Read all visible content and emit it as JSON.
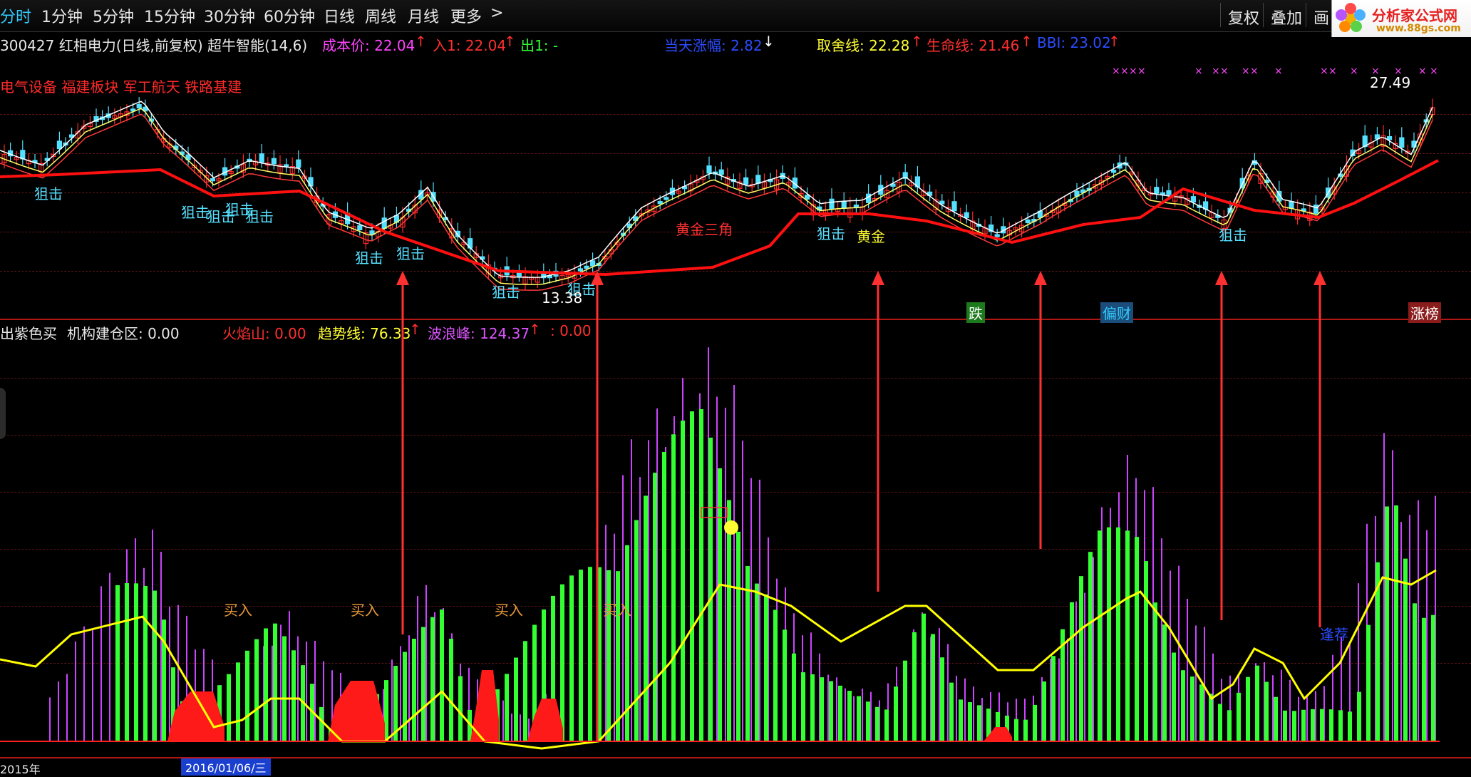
{
  "toolbar": {
    "tabs": [
      "分时",
      "1分钟",
      "5分钟",
      "15分钟",
      "30分钟",
      "60分钟",
      "日线",
      "周线",
      "月线",
      "更多"
    ],
    "more_arrow": ">",
    "right_buttons": [
      "复权",
      "叠加",
      "画"
    ],
    "logo_text": "分析家公式网",
    "logo_url": "www.88gs.com"
  },
  "main_header": {
    "title": "300427 红相电力(日线,前复权) 超牛智能(14,6)",
    "cost_label": "成本价: 22.04",
    "in_label": "入1: 22.04",
    "out_label": "出1: -",
    "day_change": "当天涨幅: 2.82",
    "qushe": "取舍线: 22.28",
    "life_line": "生命线: 21.46",
    "bbi": "BBI: 23.02",
    "sectors": "电气设备 福建板块 军工航天 铁路基建",
    "high_price": "27.49",
    "low_price": "13.38"
  },
  "annotations": {
    "snipe": "狙击",
    "golden_triangle": "黄金三角",
    "gold": "黄金",
    "drop": "跌",
    "wealth": "偏财",
    "limit_up": "涨榜",
    "buy": "买入",
    "yiyang": "逢荐"
  },
  "sub_header": {
    "purple_buy": "出紫色买",
    "inst_zone": "机构建仓区: 0.00",
    "fire_mountain": "火焰山: 0.00",
    "trend_line": "趋势线: 76.33",
    "wave_peak": "波浪峰: 124.37",
    "extra": ": 0.00"
  },
  "xaxis": {
    "year_label": "2015年",
    "cursor_date": "2016/01/06/三"
  },
  "colors": {
    "up": "#ff2a2a",
    "down": "#55e0ff",
    "green_bar": "#33ff33",
    "purple_bar": "#cc44ff",
    "trend": "#ffff00",
    "arrow": "#ff3030"
  }
}
